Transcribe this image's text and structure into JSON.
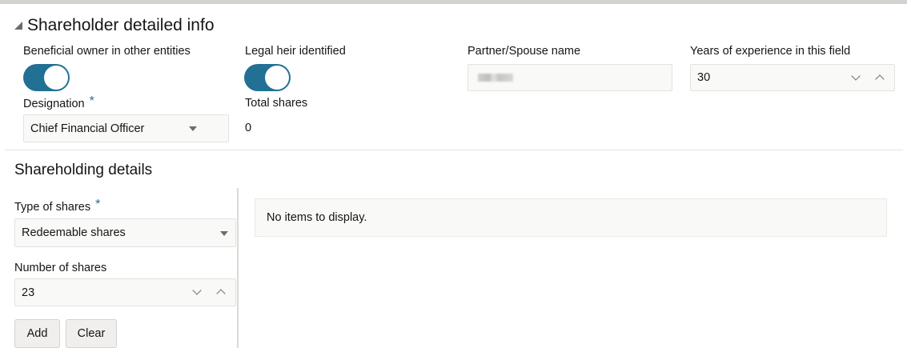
{
  "section": {
    "title": "Shareholder detailed info"
  },
  "fields": {
    "beneficial_owner_label": "Beneficial owner in other entities",
    "beneficial_owner_on": true,
    "legal_heir_label": "Legal heir identified",
    "legal_heir_on": true,
    "partner_label": "Partner/Spouse name",
    "experience_label": "Years of experience in this field",
    "experience_value": "30",
    "designation_label": "Designation",
    "designation_required": "*",
    "designation_value": "Chief Financial Officer",
    "total_shares_label": "Total shares",
    "total_shares_value": "0"
  },
  "shareholding": {
    "title": "Shareholding details",
    "type_label": "Type of shares",
    "type_required": "*",
    "type_value": "Redeemable shares",
    "number_label": "Number of shares",
    "number_value": "23",
    "add_label": "Add",
    "clear_label": "Clear",
    "empty_message": "No items to display."
  },
  "icons": {
    "collapse": "collapse-triangle-icon",
    "select": "caret-down-icon",
    "step_down": "chevron-down-icon",
    "step_up": "chevron-up-icon"
  },
  "colors": {
    "accent": "#227093",
    "field_bg": "#f9f9f8",
    "text": "#161513"
  }
}
